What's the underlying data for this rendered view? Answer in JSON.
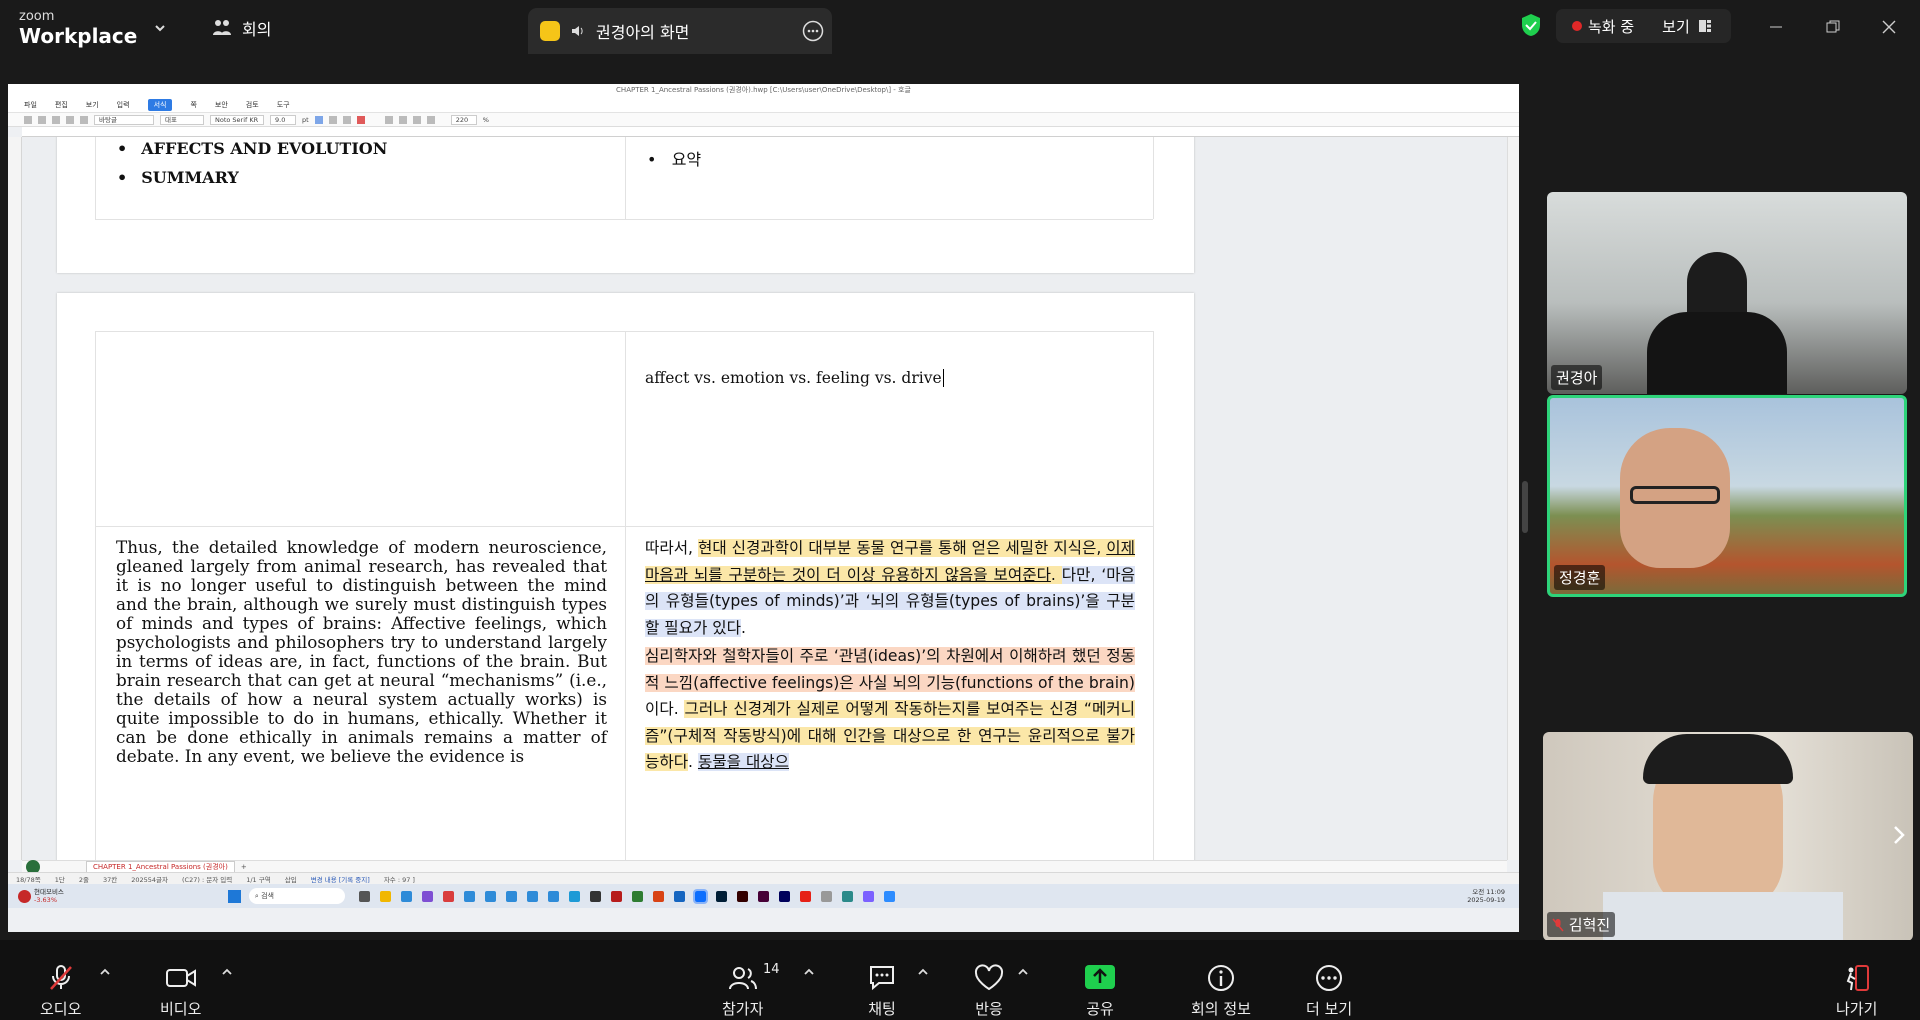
{
  "top": {
    "logo_line1": "zoom",
    "logo_line2": "Workplace",
    "meeting_label": "회의",
    "share_title": "권경아의 화면",
    "recording_label": "녹화 중",
    "view_label": "보기"
  },
  "document": {
    "window_title": "CHAPTER 1_Ancestral Passions (권경아).hwp [C:\\Users\\user\\OneDrive\\Desktop\\] - 호글",
    "menus": [
      "파일",
      "편집",
      "보기",
      "입력",
      "서식",
      "쪽",
      "보안",
      "검토",
      "도구"
    ],
    "active_menu": "서식",
    "toolbar": {
      "style": "바탕글",
      "para": "대표",
      "font": "Noto Serif KR",
      "size": "9.0",
      "unit": "pt",
      "zoom": "220",
      "zoom_unit": "%"
    },
    "bullets_en": [
      "AFFECTS AND EVOLUTION",
      "SUMMARY"
    ],
    "bullets_ko": [
      "요약"
    ],
    "cursor_text": "affect vs. emotion vs. feeling vs. drive",
    "paragraph_en": "Thus, the detailed knowledge of modern neuroscience, gleaned largely from animal research, has revealed that it is no longer useful to distinguish between the mind and the brain, although we surely must distinguish types of minds and types of brains: Affective feelings, which psychologists and philosophers try to understand largely in terms of ideas are, in fact, functions of the brain. But brain research that can get at neural “mechanisms” (i.e., the details of how a neural system actually works) is quite impossible to do in humans, ethically. Whether it can be done ethically in animals remains a matter of debate. In any event, we believe the evidence is",
    "paragraph_ko_1": {
      "a": "따라서, ",
      "b": "현대 신경과학이 대부분 동물 연구를 통해 얻은 세밀한 지식은, ",
      "c": "이제 마음과 뇌를 구분하는 것이 더 이상 유용하지 않음을 보여준다",
      "d": ". ",
      "e": "다만, ‘마음의 유형들(types of minds)’과 ‘뇌의 유형들(types of brains)’을 구분할 필요가 있다",
      "f": "."
    },
    "paragraph_ko_2": {
      "a": "심리학자와 철학자들이 주로 ‘관념(ideas)’의 차원에서 이해하려 했던 정동적 느낌(affective feelings)은 사실 뇌의 기능(functions of the brain)",
      "b": "이다. ",
      "c": "그러나 신경계가 실제로 어떻게 작동하는지를 보여주는 신경 “메커니즘”(구체적 작동방식)에 대해 인간을 대상으로 한 연구는 윤리적으로 불가능하다",
      "d": ". ",
      "e": "동물을 대상으"
    },
    "sheet_tab": "CHAPTER 1_Ancestral Passions (권경아)",
    "status_items": [
      "18/78쪽",
      "1단",
      "2줄",
      "37칸",
      "202554글자",
      "(C27) : 문자 입력",
      "1/1 구역",
      "삽입",
      "변경 내용 [기록 중지]",
      "자수 : 97 ]"
    ],
    "taskbar_search": "검색",
    "taskbar_stock_name": "현대모비스",
    "taskbar_stock_change": "-3.63%",
    "clock_time": "오전 11:09",
    "clock_date": "2025-09-19"
  },
  "participants": [
    {
      "name": "권경아"
    },
    {
      "name": "정경훈"
    },
    {
      "name": "김혁진"
    }
  ],
  "bottom_bar": {
    "audio": "오디오",
    "video": "비디오",
    "participants": "참가자",
    "participant_count": "14",
    "chat": "채팅",
    "react": "반응",
    "share": "공유",
    "info": "회의 정보",
    "more": "더 보기",
    "leave": "나가기"
  },
  "colors": {
    "active_speaker": "#2ed47a",
    "share_green": "#1fcf4e",
    "leave_red": "#e03a3a",
    "highlight_yellow": "#fbe7a8",
    "highlight_blue": "#dce4f7",
    "highlight_pink": "#fbd7c3"
  }
}
